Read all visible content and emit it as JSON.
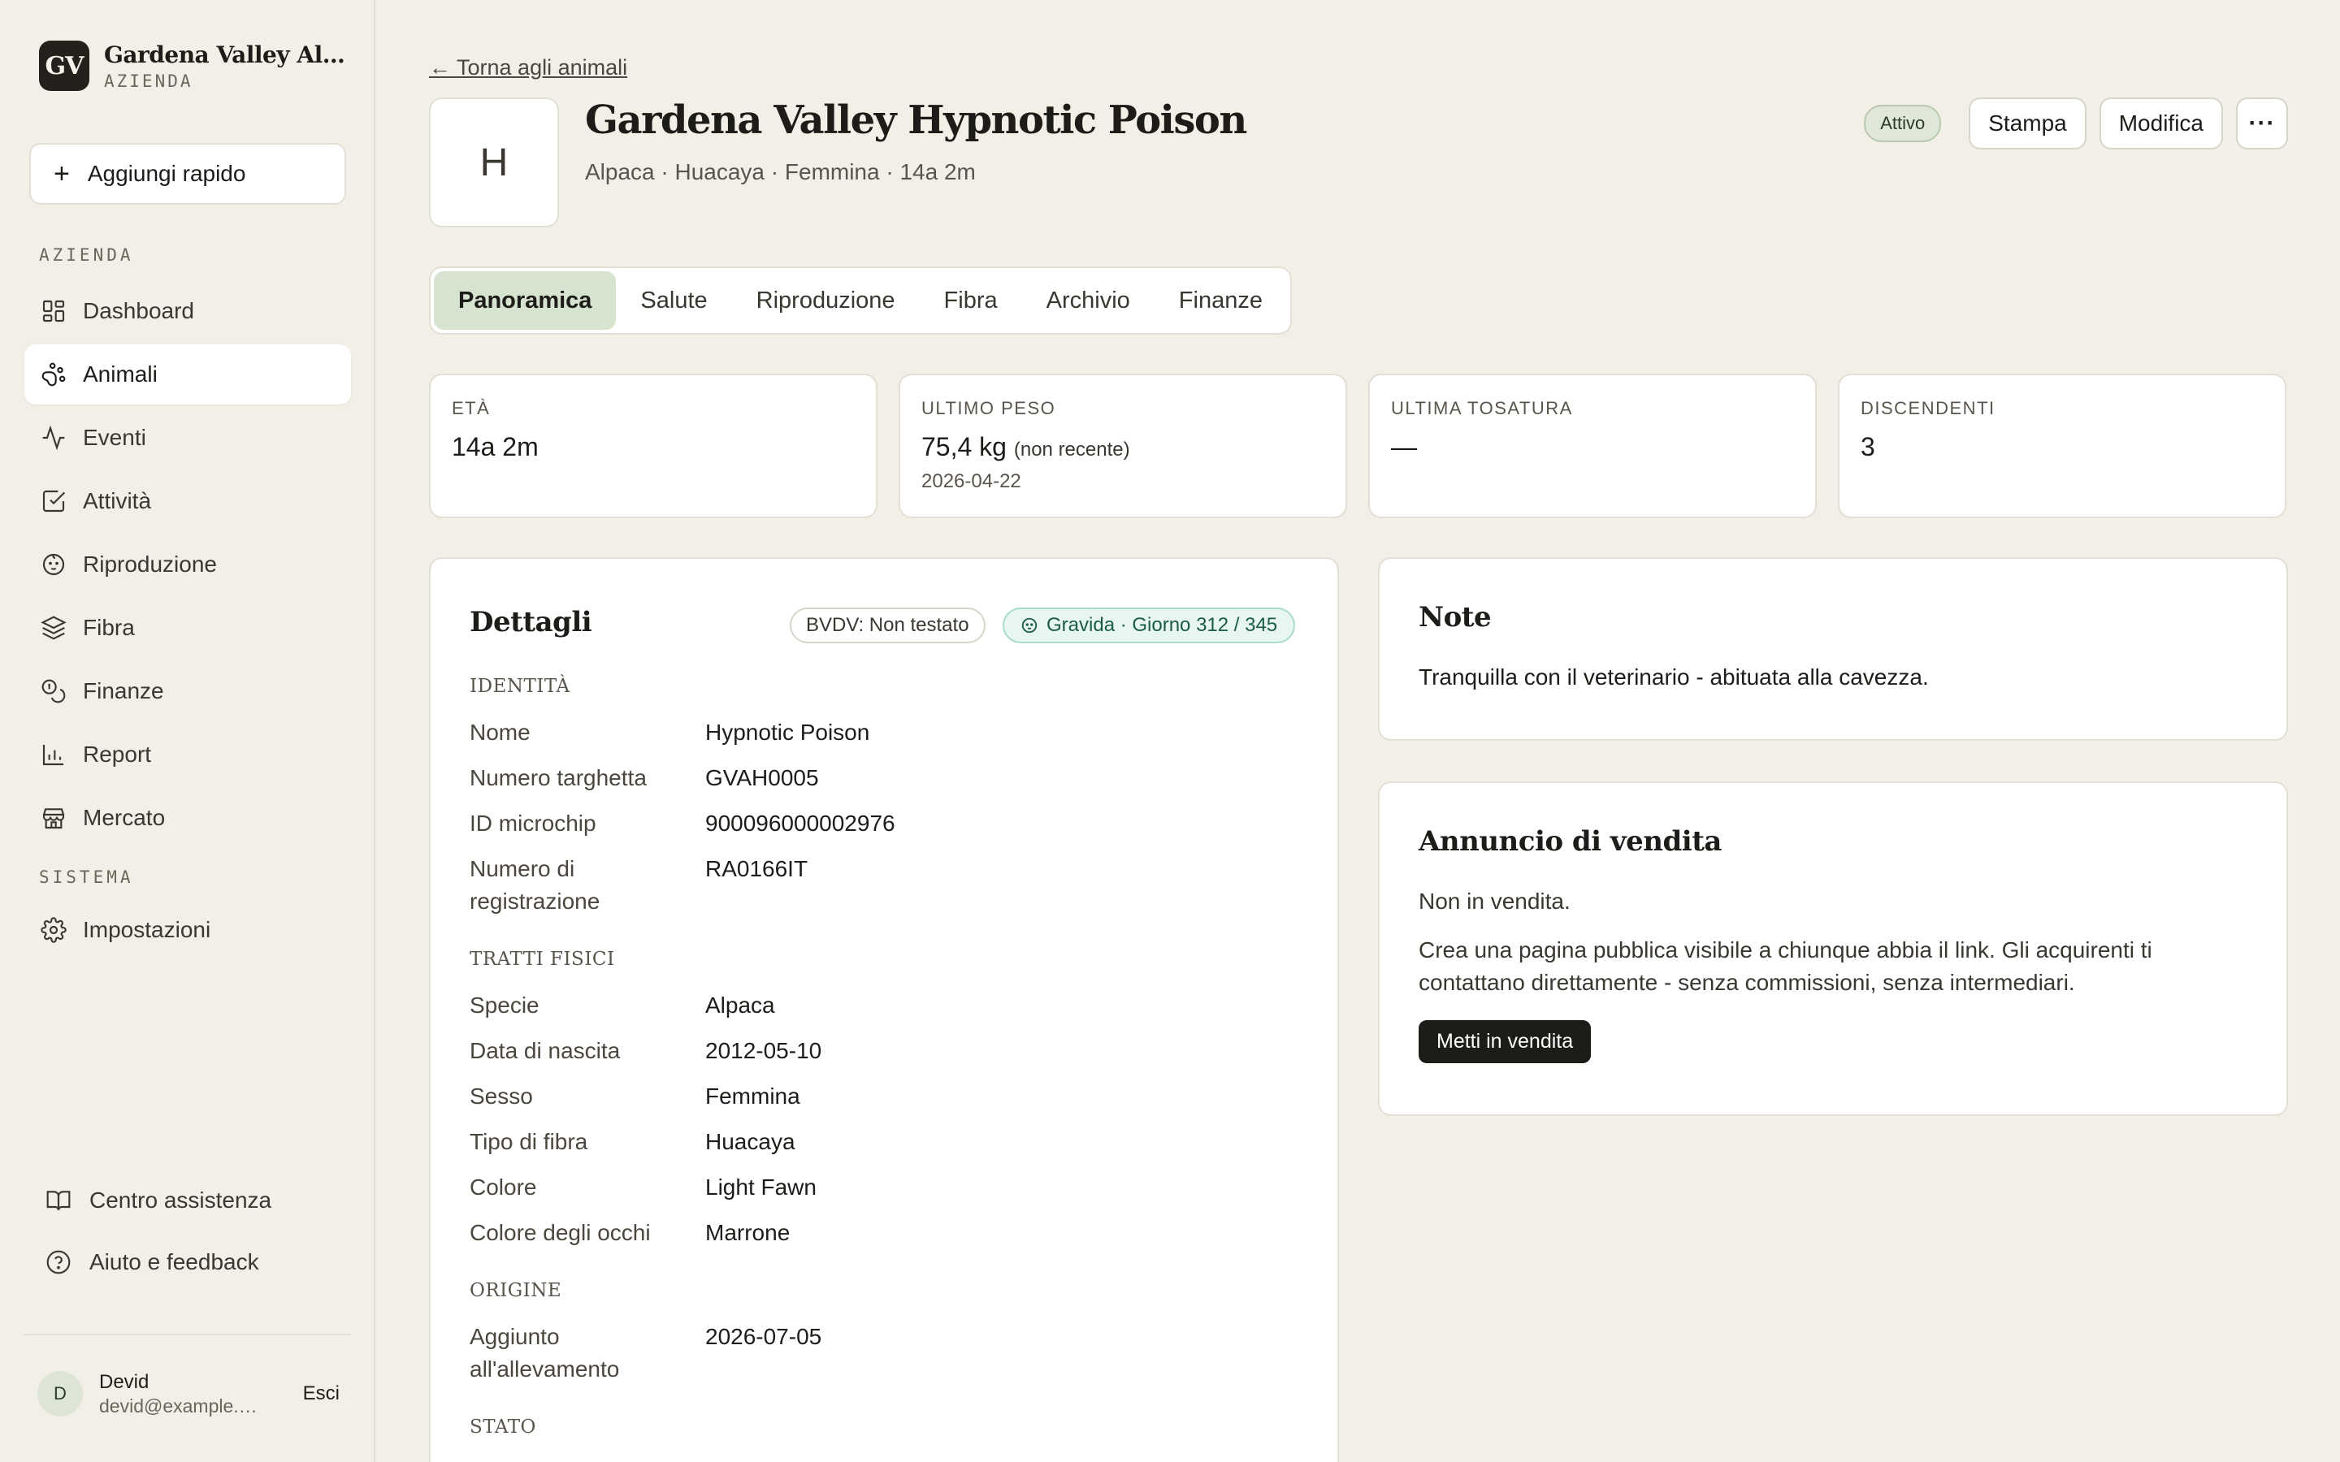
{
  "brand": {
    "logo": "GV",
    "name": "Gardena Valley Alpaca Farm",
    "subtitle": "AZIENDA"
  },
  "quick_add": {
    "label": "Aggiungi rapido"
  },
  "nav": {
    "section_farm": "AZIENDA",
    "section_system": "SISTEMA",
    "items": [
      {
        "label": "Dashboard",
        "icon": "grid-icon"
      },
      {
        "label": "Animali",
        "icon": "paw-icon",
        "active": true
      },
      {
        "label": "Eventi",
        "icon": "activity-icon"
      },
      {
        "label": "Attività",
        "icon": "checkbox-icon"
      },
      {
        "label": "Riproduzione",
        "icon": "baby-icon"
      },
      {
        "label": "Fibra",
        "icon": "layers-icon"
      },
      {
        "label": "Finanze",
        "icon": "coins-icon"
      },
      {
        "label": "Report",
        "icon": "bar-chart-icon"
      },
      {
        "label": "Mercato",
        "icon": "store-icon"
      }
    ],
    "settings": {
      "label": "Impostazioni",
      "icon": "gear-icon"
    }
  },
  "help": {
    "center": "Centro assistenza",
    "feedback": "Aiuto e feedback"
  },
  "user": {
    "initial": "D",
    "name": "Devid",
    "email": "devid@example.com",
    "logout": "Esci"
  },
  "page": {
    "back_link": "← Torna agli animali",
    "avatar_initial": "H",
    "title": "Gardena Valley Hypnotic Poison",
    "meta": "Alpaca · Huacaya · Femmina · 14a 2m",
    "status_badge": "Attivo",
    "print_button": "Stampa",
    "edit_button": "Modifica",
    "more_button": "···"
  },
  "tabs": [
    "Panoramica",
    "Salute",
    "Riproduzione",
    "Fibra",
    "Archivio",
    "Finanze"
  ],
  "active_tab": "Panoramica",
  "stats": [
    {
      "label": "ETÀ",
      "value": "14a 2m"
    },
    {
      "label": "ULTIMO PESO",
      "value": "75,4 kg",
      "note": "(non recente)",
      "sub": "2026-04-22"
    },
    {
      "label": "ULTIMA TOSATURA",
      "value": "—"
    },
    {
      "label": "DISCENDENTI",
      "value": "3"
    }
  ],
  "details": {
    "title": "Dettagli",
    "bvdv": "BVDV: Non testato",
    "pregnancy": "Gravida · Giorno 312 / 345",
    "identity": {
      "label": "IDENTITÀ",
      "rows": [
        {
          "label": "Nome",
          "value": "Hypnotic Poison"
        },
        {
          "label": "Numero targhetta",
          "value": "GVAH0005"
        },
        {
          "label": "ID microchip",
          "value": "900096000002976"
        },
        {
          "label": "Numero di registrazione",
          "value": "RA0166IT"
        }
      ]
    },
    "physical": {
      "label": "TRATTI FISICI",
      "rows": [
        {
          "label": "Specie",
          "value": "Alpaca"
        },
        {
          "label": "Data di nascita",
          "value": "2012-05-10"
        },
        {
          "label": "Sesso",
          "value": "Femmina"
        },
        {
          "label": "Tipo di fibra",
          "value": "Huacaya"
        },
        {
          "label": "Colore",
          "value": "Light Fawn"
        },
        {
          "label": "Colore degli occhi",
          "value": "Marrone"
        }
      ]
    },
    "origin": {
      "label": "ORIGINE",
      "rows": [
        {
          "label": "Aggiunto all'allevamento",
          "value": "2026-07-05"
        }
      ]
    },
    "status": {
      "label": "STATO"
    }
  },
  "notes": {
    "title": "Note",
    "text": "Tranquilla con il veterinario - abituata alla cavezza."
  },
  "sale": {
    "title": "Annuncio di vendita",
    "status": "Non in vendita.",
    "description": "Crea una pagina pubblica visibile a chiunque abbia il link. Gli acquirenti ti contattano direttamente - senza commissioni, senza intermediari.",
    "button": "Metti in vendita"
  },
  "colors": {
    "background": "#f2efe7",
    "card": "#ffffff",
    "accent_green": "#d6e3cf",
    "pregnancy_green": "#1b5c46",
    "dark": "#1e1c18"
  }
}
